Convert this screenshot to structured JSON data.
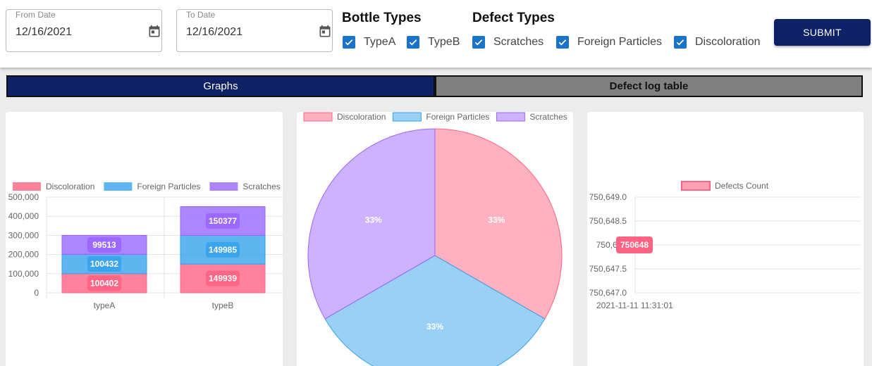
{
  "filters": {
    "from_date": {
      "label": "From Date",
      "value": "12/16/2021"
    },
    "to_date": {
      "label": "To Date",
      "value": "12/16/2021"
    },
    "bottle_types": {
      "title": "Bottle Types",
      "options": [
        "TypeA",
        "TypeB"
      ]
    },
    "defect_types": {
      "title": "Defect Types",
      "options": [
        "Scratches",
        "Foreign Particles",
        "Discoloration"
      ]
    },
    "submit_label": "SUBMIT"
  },
  "tabs": {
    "graphs": "Graphs",
    "defect_log": "Defect log table"
  },
  "colors": {
    "accent": "#0e2167",
    "checkbox": "#1a73c8",
    "discoloration": "#ff6384",
    "foreign_particles": "#36a2eb",
    "scratches": "#9966ff"
  },
  "chart_data": [
    {
      "type": "bar",
      "stacked": true,
      "categories": [
        "typeA",
        "typeB"
      ],
      "series": [
        {
          "name": "Discoloration",
          "values": [
            100402,
            149939
          ]
        },
        {
          "name": "Foreign Particles",
          "values": [
            100432,
            149985
          ]
        },
        {
          "name": "Scratches",
          "values": [
            99513,
            150377
          ]
        }
      ],
      "y_ticks": [
        "500,000",
        "400,000",
        "300,000",
        "200,000",
        "100,000",
        "0"
      ],
      "ylim": [
        0,
        500000
      ],
      "legend_position": "top",
      "grid": true
    },
    {
      "type": "pie",
      "labels": [
        "Discoloration",
        "Foreign Particles",
        "Scratches"
      ],
      "values": [
        33,
        33,
        33
      ],
      "value_labels": [
        "33%",
        "33%",
        "33%"
      ],
      "legend_position": "top"
    },
    {
      "type": "line",
      "series": [
        {
          "name": "Defects Count",
          "values": [
            750648
          ]
        }
      ],
      "x": [
        "2021-11-11 11:31:01"
      ],
      "data_labels": [
        "750648"
      ],
      "y_ticks": [
        "750,649.0",
        "750,648.5",
        "750,648",
        "750,647.5",
        "750,647.0"
      ],
      "ylim": [
        750647.0,
        750649.0
      ],
      "legend_position": "top",
      "grid": true
    }
  ]
}
